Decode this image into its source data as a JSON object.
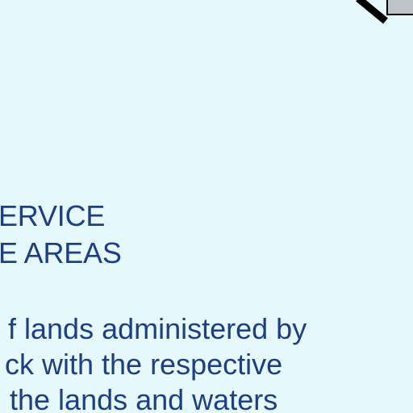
{
  "heading": {
    "line1": "ERVICE",
    "line2": "E AREAS"
  },
  "body_text": {
    "line1": "f lands administered by",
    "line2": "ck with the respective",
    "line3": "the lands and waters"
  },
  "colors": {
    "background": "#e6fafe",
    "text": "#1c3f86",
    "corner_mark": "#000000",
    "corner_box": "#bfc4c8"
  }
}
